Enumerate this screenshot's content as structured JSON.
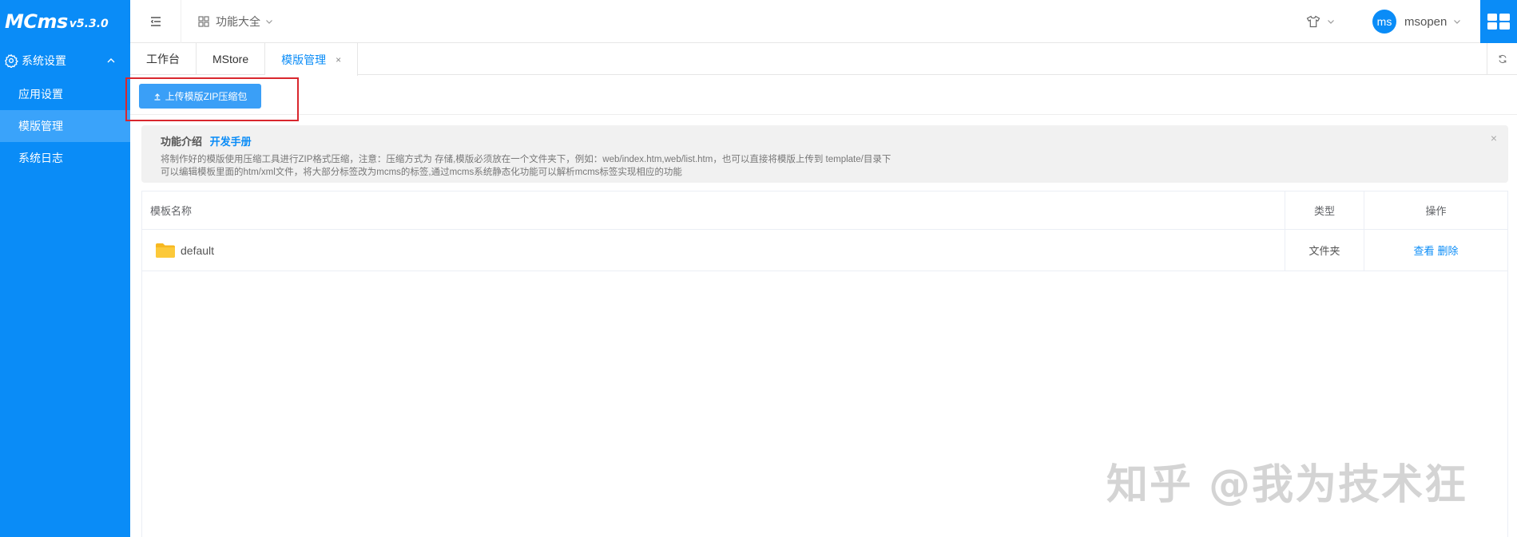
{
  "app": {
    "logo_name": "MCms",
    "logo_version": "v5.3.0"
  },
  "sidebar": {
    "group_label": "系统设置",
    "items": [
      {
        "label": "应用设置"
      },
      {
        "label": "模版管理"
      },
      {
        "label": "系统日志"
      }
    ]
  },
  "header": {
    "func_all_label": "功能大全",
    "avatar_text": "ms",
    "username": "msopen"
  },
  "tabs": [
    {
      "label": "工作台"
    },
    {
      "label": "MStore"
    },
    {
      "label": "模版管理"
    }
  ],
  "tab_close_glyph": "×",
  "toolbar": {
    "upload_label": "上传模版ZIP压缩包"
  },
  "info": {
    "title": "功能介绍",
    "link": "开发手册",
    "line1": "将制作好的模版使用压缩工具进行ZIP格式压缩，注意：压缩方式为 存储,模版必须放在一个文件夹下，例如：web/index.htm,web/list.htm，也可以直接将模版上传到 template/目录下",
    "line2": "可以编辑模板里面的htm/xml文件，将大部分标签改为mcms的标签,通过mcms系统静态化功能可以解析mcms标签实现相应的功能",
    "close_glyph": "×"
  },
  "table": {
    "headers": {
      "name": "模板名称",
      "type": "类型",
      "op": "操作"
    },
    "rows": [
      {
        "name": "default",
        "type": "文件夹",
        "view": "查看",
        "delete": "删除"
      }
    ]
  },
  "watermark": "知乎 @我为技术狂",
  "colors": {
    "primary": "#0a8cf7",
    "highlight_border": "#d9272e"
  },
  "icons": [
    "menu-icon",
    "grid-icon",
    "chevron-down-icon",
    "shirt-icon",
    "apps-icon",
    "refresh-icon",
    "upload-icon",
    "gear-icon",
    "chevron-up-icon",
    "folder-icon"
  ]
}
